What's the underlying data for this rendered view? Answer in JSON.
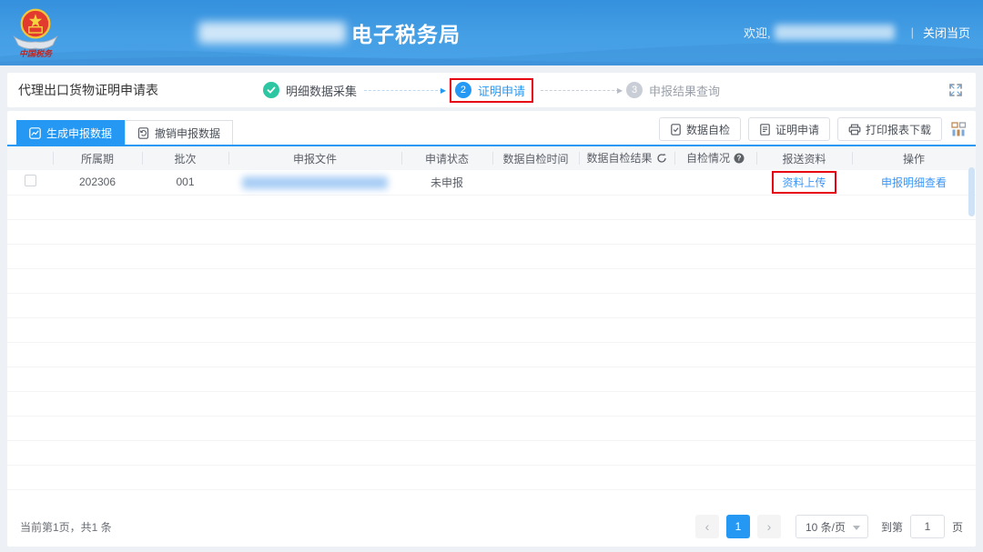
{
  "header": {
    "title": "电子税务局",
    "welcome": "欢迎,",
    "close_label": "关闭当页"
  },
  "page": {
    "title": "代理出口货物证明申请表",
    "steps": {
      "step1_label": "明细数据采集",
      "step2_num": "2",
      "step2_label": "证明申请",
      "step3_num": "3",
      "step3_label": "申报结果查询"
    }
  },
  "toolbar": {
    "tab_generate": "生成申报数据",
    "tab_revoke": "撤销申报数据",
    "btn_selfcheck": "数据自检",
    "btn_apply": "证明申请",
    "btn_print": "打印报表下载"
  },
  "table": {
    "columns": [
      "所属期",
      "批次",
      "申报文件",
      "申请状态",
      "数据自检时间",
      "数据自检结果",
      "自检情况",
      "报送资料",
      "操作"
    ],
    "row": {
      "period": "202306",
      "batch": "001",
      "status": "未申报",
      "upload_link": "资料上传",
      "detail_link": "申报明细查看"
    }
  },
  "footer": {
    "summary": "当前第1页，共1 条",
    "prev": "‹",
    "page": "1",
    "next": "›",
    "page_size": "10 条/页",
    "goto_prefix": "到第",
    "goto_value": "1",
    "goto_suffix": "页"
  },
  "colors": {
    "accent_blue": "#2598f4",
    "link_blue": "#3a96f8",
    "annotation_red": "#e60012",
    "step_done_green": "#2cc7a2"
  }
}
